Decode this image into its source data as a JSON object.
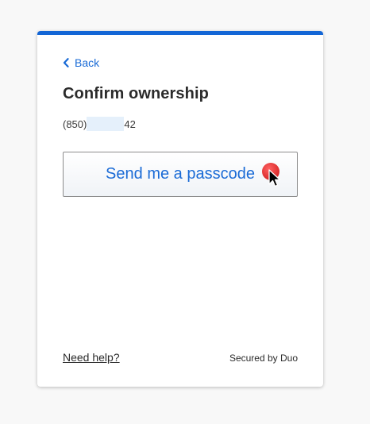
{
  "colors": {
    "accent": "#1a6bd6",
    "topbar": "#1366d6",
    "title": "#2b2b2b"
  },
  "nav": {
    "back_label": "Back",
    "back_icon": "chevron-left-icon"
  },
  "page": {
    "title": "Confirm ownership",
    "phone_prefix": "(850)",
    "phone_suffix": "42"
  },
  "actions": {
    "send_passcode_label": "Send me a passcode"
  },
  "footer": {
    "help_label": "Need help?",
    "secured_label": "Secured by Duo"
  }
}
